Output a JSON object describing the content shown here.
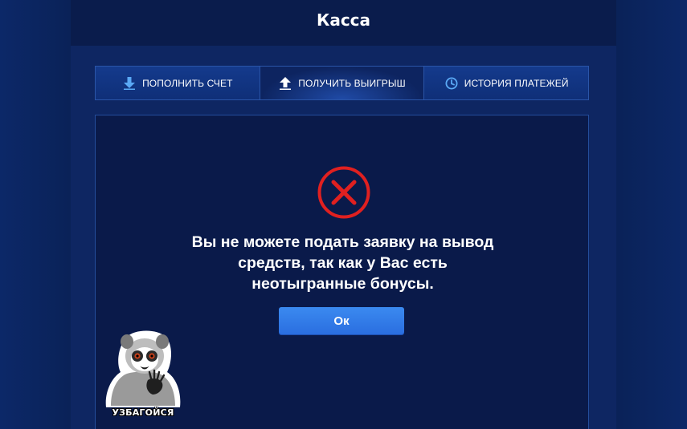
{
  "header": {
    "title": "Касса"
  },
  "tabs": [
    {
      "label": "ПОПОЛНИТЬ СЧЕТ",
      "icon": "arrow-down-icon",
      "active": false
    },
    {
      "label": "ПОЛУЧИТЬ ВЫИГРЫШ",
      "icon": "arrow-up-icon",
      "active": true
    },
    {
      "label": "ИСТОРИЯ ПЛАТЕЖЕЙ",
      "icon": "clock-icon",
      "active": false
    }
  ],
  "dialog": {
    "icon": "error-x-icon",
    "message_line1": "Вы не можете подать заявку на вывод",
    "message_line2": "средств, так как у Вас есть",
    "message_line3": "неотыгранные бонусы.",
    "ok_label": "Ок"
  },
  "sticker": {
    "icon": "lemur-sticker",
    "caption": "УЗБАГОЙСЯ"
  },
  "colors": {
    "background": "#0b2461",
    "header": "#0a1c4c",
    "panel": "#0e2662",
    "content": "#0a1a4a",
    "button": "#2f78e8",
    "error_red": "#e02020",
    "tab_icon_blue": "#5aa9f5"
  }
}
